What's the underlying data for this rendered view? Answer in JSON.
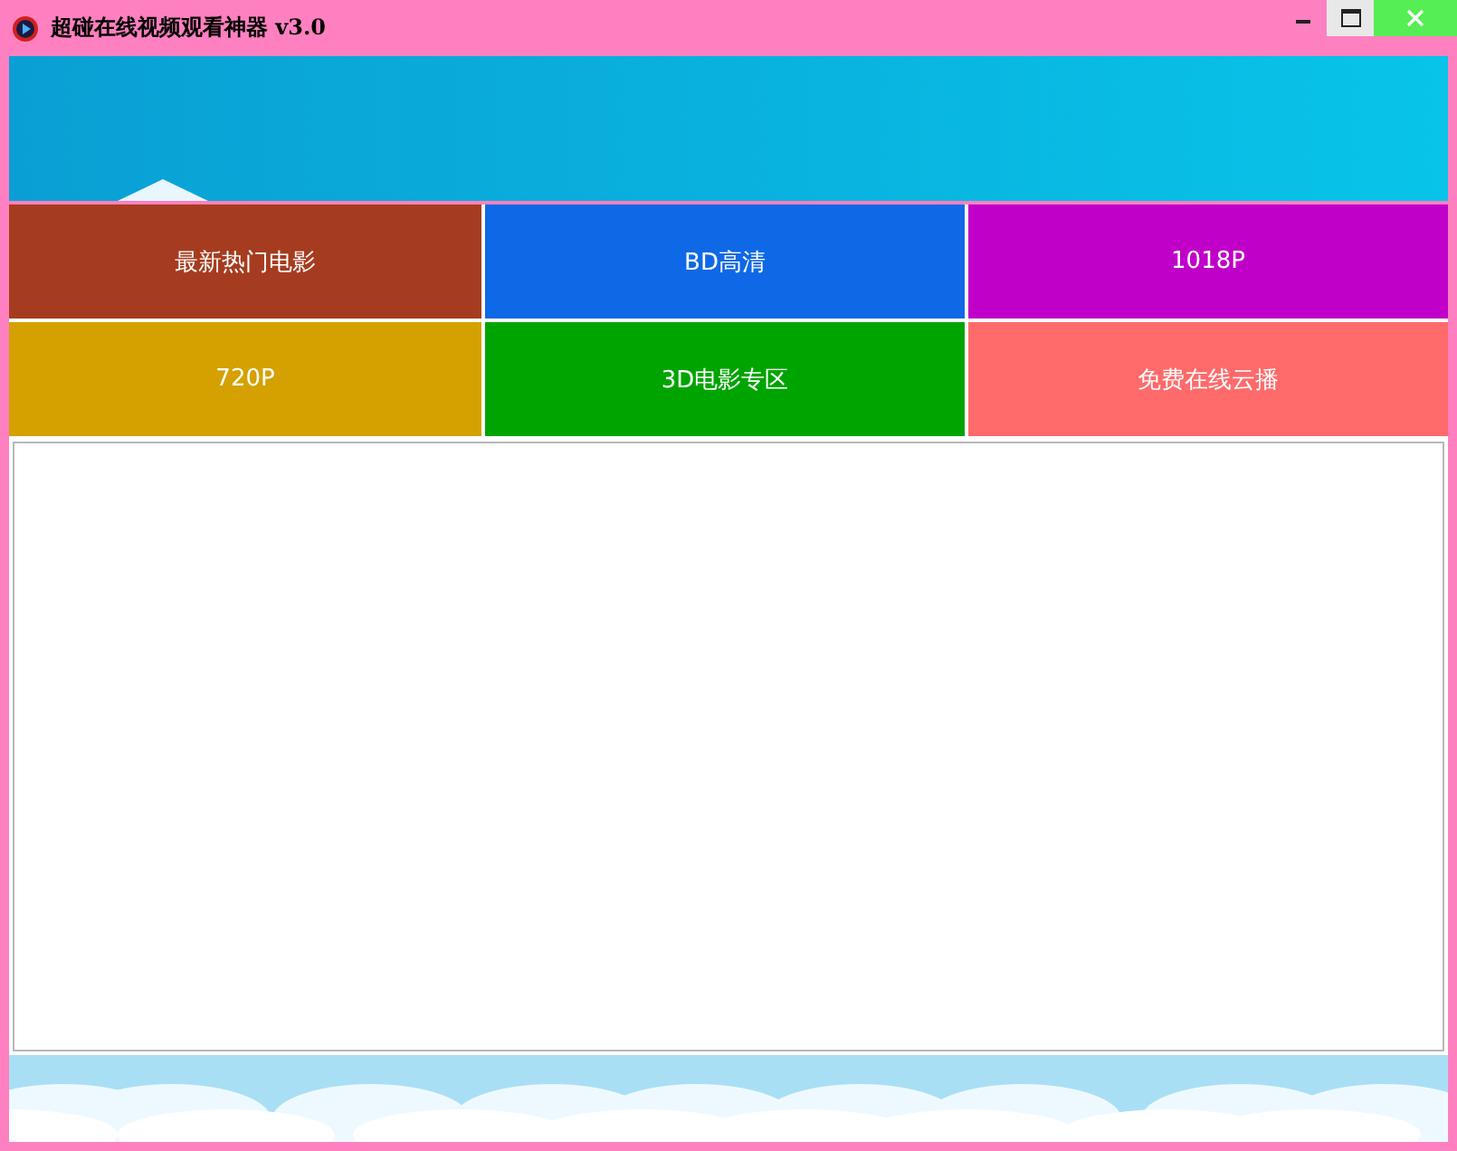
{
  "window": {
    "title": "超碰在线视频观看神器 v3.0"
  },
  "tiles": [
    {
      "label": "最新热门电影",
      "color": "#a63c1f"
    },
    {
      "label": "BD高清",
      "color": "#0f68e6"
    },
    {
      "label": "1018P",
      "color": "#c000c8"
    },
    {
      "label": "720P",
      "color": "#d4a100"
    },
    {
      "label": "3D电影专区",
      "color": "#00a400"
    },
    {
      "label": "免费在线云播",
      "color": "#ff6a6a"
    }
  ]
}
